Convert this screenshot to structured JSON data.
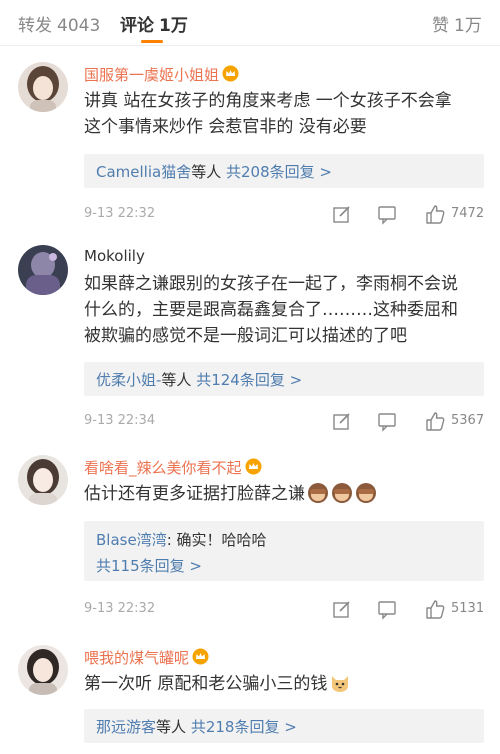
{
  "tabs": {
    "repost": {
      "label": "转发",
      "count": "4043"
    },
    "comment": {
      "label": "评论",
      "count": "1万"
    },
    "like": {
      "label": "赞",
      "count": "1万"
    }
  },
  "colors": {
    "accent": "#ff8200",
    "username": "#eb7350",
    "link": "#507daf",
    "reply_bg": "#f2f2f2"
  },
  "comments": [
    {
      "username": "国服第一虞姬小姐姐",
      "vip_icon": "vip-crown-icon",
      "lines": [
        "讲真 站在女孩子的角度来考虑 一个女孩子不会拿",
        "这个事情来炒作 会惹官非的 没有必要"
      ],
      "reply": {
        "user": "Camellia猫舍",
        "suffix": "等人",
        "count_text": "共208条回复 >"
      },
      "time": "9-13 22:32",
      "likes": "7472"
    },
    {
      "username": "Mokolily",
      "lines": [
        "如果薛之谦跟别的女孩子在一起了，李雨桐不会说",
        "什么的，主要是跟高磊鑫复合了………这种委屈和",
        "被欺骗的感觉不是一般词汇可以描述的了吧"
      ],
      "reply": {
        "user": "优柔小姐-",
        "suffix": "等人",
        "count_text": "共124条回复 >"
      },
      "time": "9-13 22:34",
      "likes": "5367"
    },
    {
      "username": "看啥看_辣么美你看不起",
      "vip_icon": "vip-crown-icon",
      "lines": [
        "估计还有更多证据打脸薛之谦"
      ],
      "emojis": [
        "see-no-evil-monkey-emoji",
        "see-no-evil-monkey-emoji",
        "see-no-evil-monkey-emoji"
      ],
      "reply": {
        "user": "Blase湾湾",
        "text": ": 确实！哈哈哈",
        "count_text": "共115条回复 >"
      },
      "time": "9-13 22:32",
      "likes": "5131"
    },
    {
      "username": "喂我的煤气罐呢",
      "vip_icon": "vip-crown-icon",
      "lines": [
        "第一次听 原配和老公骗小三的钱"
      ],
      "emojis": [
        "cat-emoji"
      ],
      "reply": {
        "user": "那远游客",
        "suffix": "等人",
        "count_text": "共218条回复 >"
      }
    }
  ]
}
